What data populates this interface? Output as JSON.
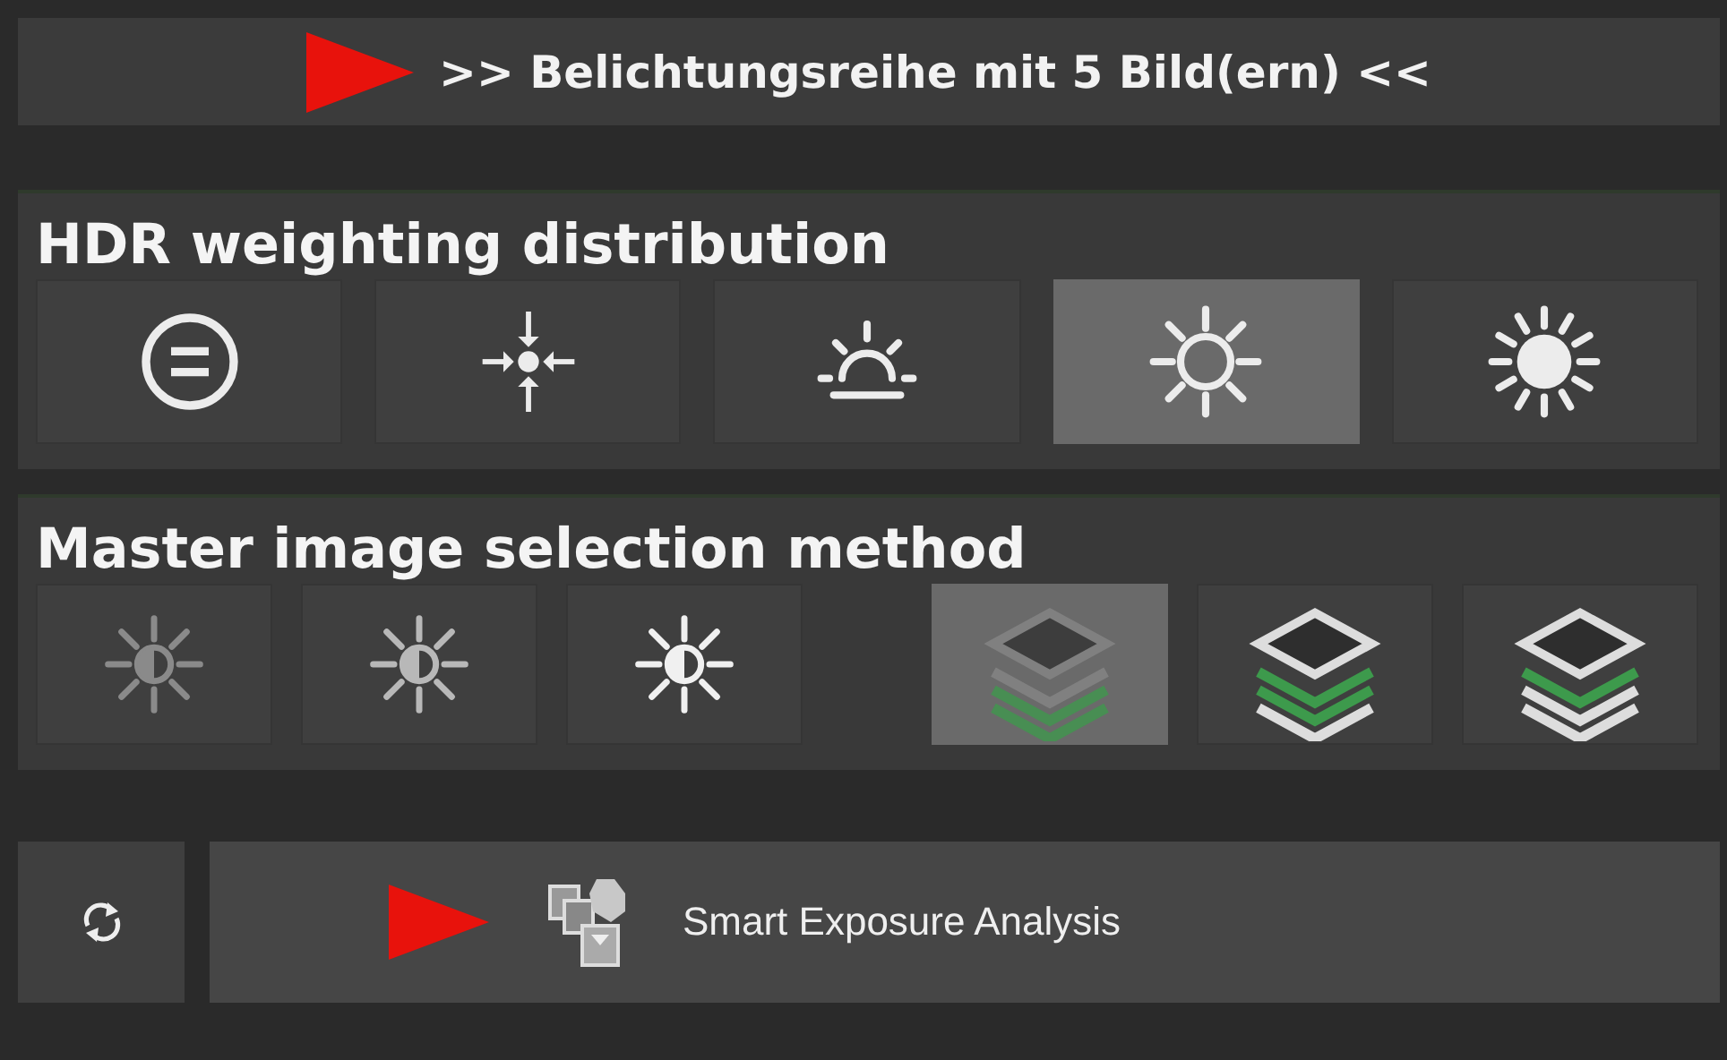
{
  "header": {
    "title": ">> Belichtungsreihe mit 5 Bild(ern) <<"
  },
  "hdr_weighting": {
    "title": "HDR weighting distribution",
    "options": [
      {
        "kind": "equal",
        "selected": false
      },
      {
        "kind": "center",
        "selected": false
      },
      {
        "kind": "sunrise",
        "selected": false
      },
      {
        "kind": "sun-outline",
        "selected": true
      },
      {
        "kind": "sun-filled",
        "selected": false
      }
    ]
  },
  "master_selection": {
    "title": "Master image selection method",
    "options": [
      {
        "kind": "sun-dim",
        "selected": false
      },
      {
        "kind": "sun-mid",
        "selected": false
      },
      {
        "kind": "sun-bright",
        "selected": false
      },
      {
        "kind": "layers-bottom",
        "selected": true
      },
      {
        "kind": "layers-middle",
        "selected": false
      },
      {
        "kind": "layers-top",
        "selected": false
      }
    ]
  },
  "analysis_button": {
    "label": "Smart Exposure Analysis"
  }
}
